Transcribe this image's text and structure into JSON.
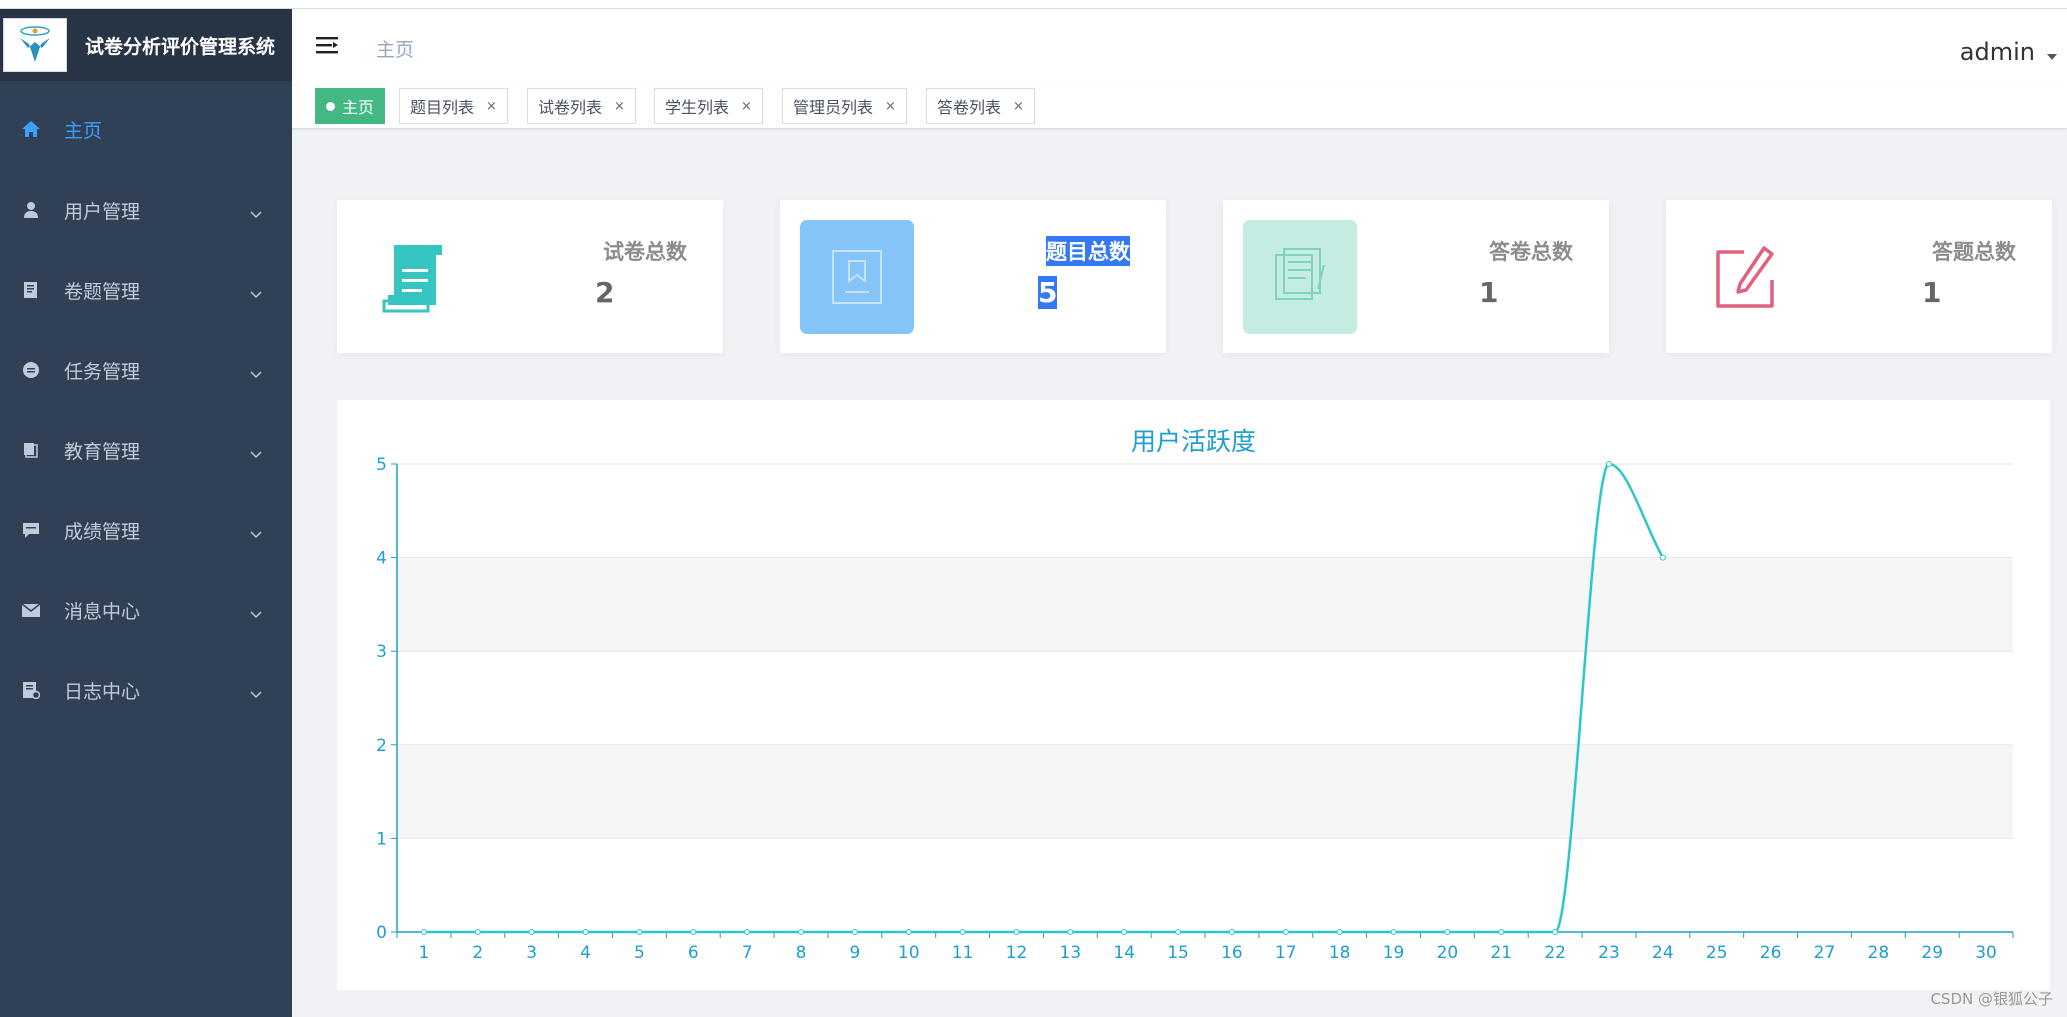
{
  "app": {
    "title": "试卷分析评价管理系统"
  },
  "sidebar": {
    "items": [
      {
        "label": "主页",
        "icon": "home-icon",
        "active": true
      },
      {
        "label": "用户管理",
        "icon": "user-icon"
      },
      {
        "label": "卷题管理",
        "icon": "book-icon"
      },
      {
        "label": "任务管理",
        "icon": "task-icon"
      },
      {
        "label": "教育管理",
        "icon": "education-icon"
      },
      {
        "label": "成绩管理",
        "icon": "chat-icon"
      },
      {
        "label": "消息中心",
        "icon": "mail-icon"
      },
      {
        "label": "日志中心",
        "icon": "log-icon"
      }
    ]
  },
  "header": {
    "breadcrumb": "主页",
    "user": "admin"
  },
  "tags": [
    {
      "label": "主页",
      "active": true
    },
    {
      "label": "题目列表"
    },
    {
      "label": "试卷列表"
    },
    {
      "label": "学生列表"
    },
    {
      "label": "管理员列表"
    },
    {
      "label": "答卷列表"
    }
  ],
  "tag_close": "×",
  "cards": [
    {
      "label": "试卷总数",
      "value": "2",
      "icon": "scroll-icon",
      "bg": "#ffffff",
      "icon_color": "#36c5c0"
    },
    {
      "label": "题目总数",
      "value": "5",
      "icon": "bookmark-icon",
      "bg": "#85c4f8",
      "icon_color": "#c8e2fa"
    },
    {
      "label": "答卷总数",
      "value": "1",
      "icon": "documents-icon",
      "bg": "#c4ece3",
      "icon_color": "#7fd3bd"
    },
    {
      "label": "答题总数",
      "value": "1",
      "icon": "edit-icon",
      "bg": "#ffffff",
      "icon_color": "#e0607e"
    }
  ],
  "chart_data": {
    "type": "line",
    "title": "用户活跃度",
    "categories": [
      "1",
      "2",
      "3",
      "4",
      "5",
      "6",
      "7",
      "8",
      "9",
      "10",
      "11",
      "12",
      "13",
      "14",
      "15",
      "16",
      "17",
      "18",
      "19",
      "20",
      "21",
      "22",
      "23",
      "24",
      "25",
      "26",
      "27",
      "28",
      "29",
      "30"
    ],
    "series": [
      {
        "values": [
          0,
          0,
          0,
          0,
          0,
          0,
          0,
          0,
          0,
          0,
          0,
          0,
          0,
          0,
          0,
          0,
          0,
          0,
          0,
          0,
          0,
          0,
          5,
          4
        ]
      }
    ],
    "ylim": [
      0,
      5
    ],
    "yticks": [
      "0",
      "1",
      "2",
      "3",
      "4",
      "5"
    ],
    "smooth": true,
    "colors": {
      "line": "#2ec7c9",
      "axis": "#1e9fd0",
      "band": "#f6f6f6"
    }
  },
  "watermark": "CSDN @银狐公子"
}
